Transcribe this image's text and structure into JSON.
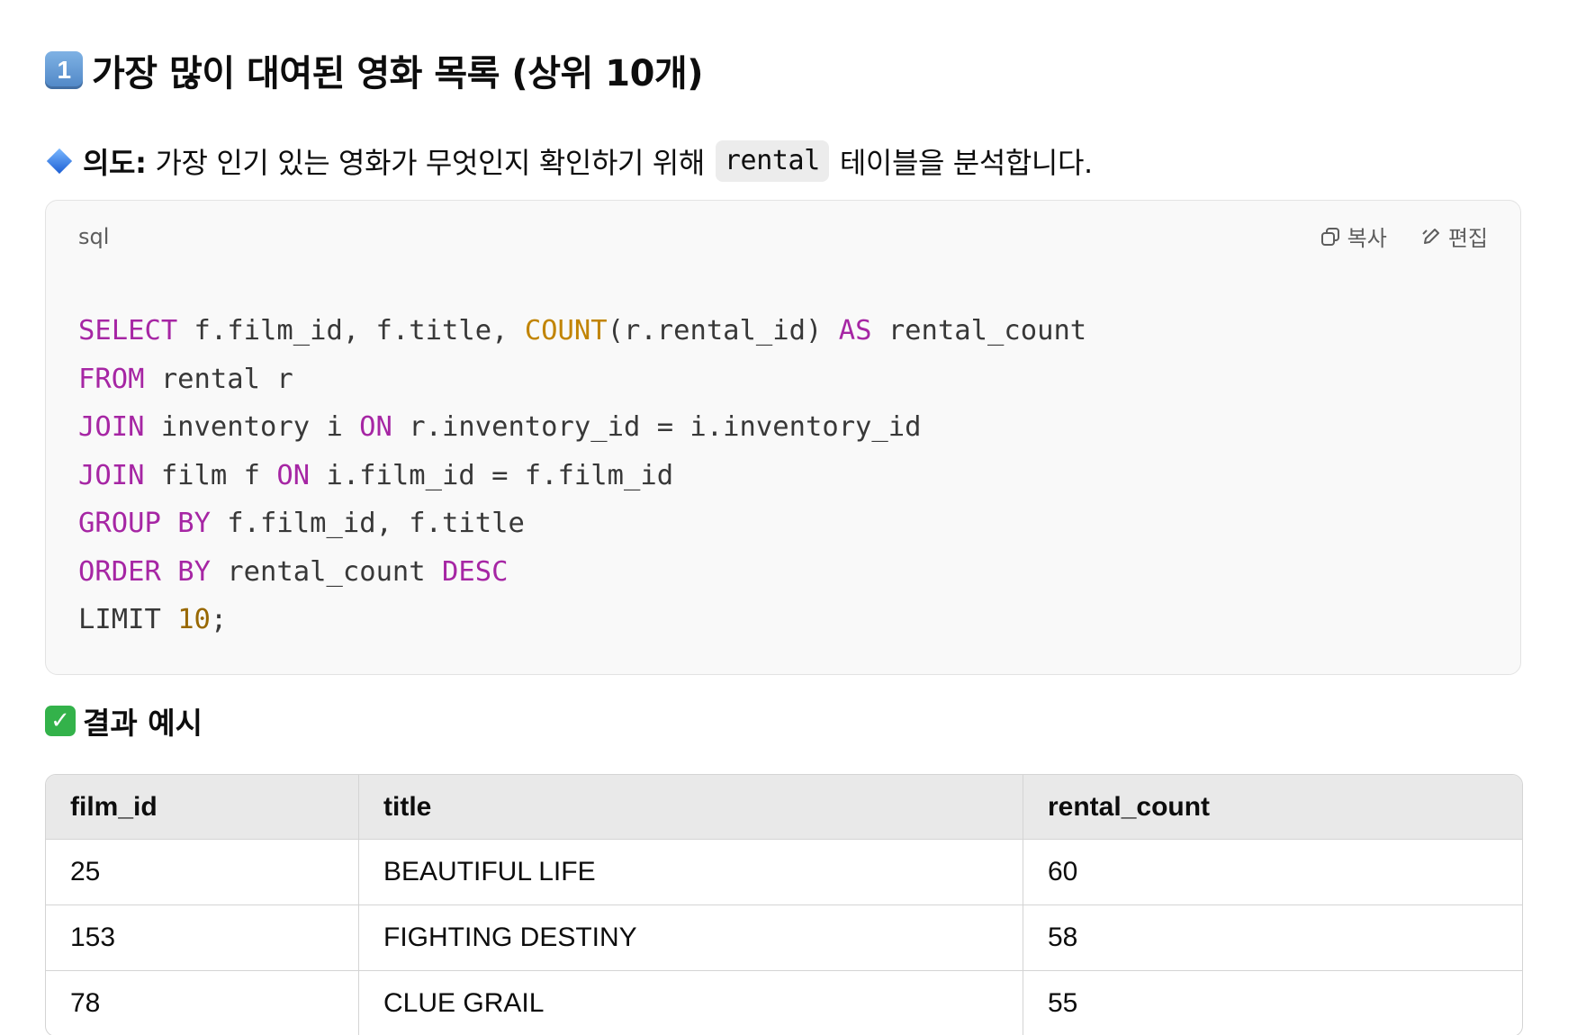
{
  "heading": {
    "number": "1",
    "text": "가장 많이 대여된 영화 목록 (상위 10개)"
  },
  "intent": {
    "label": "의도:",
    "text_before": "가장 인기 있는 영화가 무엇인지 확인하기 위해",
    "code": "rental",
    "text_after": "테이블을 분석합니다."
  },
  "code_block": {
    "language": "sql",
    "copy_label": "복사",
    "edit_label": "편집",
    "lines": [
      "SELECT f.film_id, f.title, COUNT(r.rental_id) AS rental_count",
      "FROM rental r",
      "JOIN inventory i ON r.inventory_id = i.inventory_id",
      "JOIN film f ON i.film_id = f.film_id",
      "GROUP BY f.film_id, f.title",
      "ORDER BY rental_count DESC",
      "LIMIT 10;"
    ],
    "syntax_colors": {
      "keyword": "#a626a4",
      "function": "#c18401",
      "number": "#986801",
      "text": "#383838"
    }
  },
  "result": {
    "title": "결과 예시",
    "columns": [
      "film_id",
      "title",
      "rental_count"
    ],
    "rows": [
      [
        "25",
        "BEAUTIFUL LIFE",
        "60"
      ],
      [
        "153",
        "FIGHTING DESTINY",
        "58"
      ],
      [
        "78",
        "CLUE GRAIL",
        "55"
      ]
    ]
  }
}
